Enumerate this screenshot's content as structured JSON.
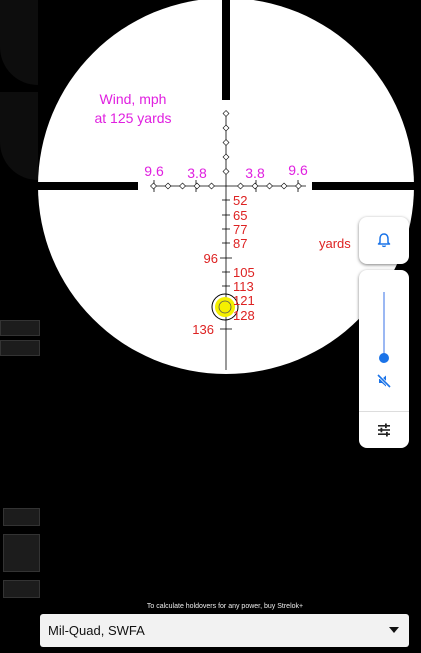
{
  "reticle": {
    "wind_label": "Wind, mph",
    "range_label": "at 125 yards",
    "wind_left": [
      "9.6",
      "3.8"
    ],
    "wind_right": [
      "3.8",
      "9.6"
    ],
    "yards_label": "yards",
    "holdovers": [
      "52",
      "65",
      "77",
      "87",
      "96",
      "105",
      "113",
      "121",
      "128",
      "136"
    ],
    "colors": {
      "wind": "#e020e0",
      "holdover": "#dd2222",
      "target": "#f5f000",
      "crosshair": "#000000"
    }
  },
  "volume_panel": {
    "bell_icon": "bell-icon",
    "mute_icon": "mute-icon",
    "settings_icon": "sliders-icon",
    "level": 0.0,
    "accent": "#1a73e8"
  },
  "footer": {
    "promo": "To calculate holdovers for any power, buy Strelok+",
    "scope_name": "Mil-Quad, SWFA"
  }
}
